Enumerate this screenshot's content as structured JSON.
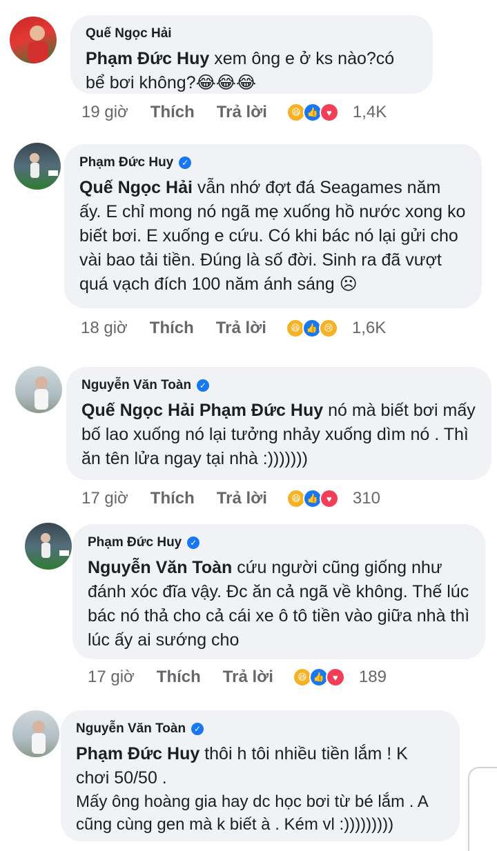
{
  "comments": [
    {
      "author": "Quế Ngọc Hải",
      "verified": false,
      "mention": "Phạm Đức Huy",
      "text": " xem ông e ở ks nào?có bể bơi không?😂😂😂",
      "time": "19 giờ",
      "like_label": "Thích",
      "reply_label": "Trả lời",
      "reactions": [
        "haha",
        "like",
        "love"
      ],
      "reaction_count": "1,4K"
    },
    {
      "author": "Phạm Đức Huy",
      "verified": true,
      "mention": "Quế Ngọc Hải",
      "text": " vẫn nhớ đợt đá Seagames năm ấy. E chỉ mong nó ngã mẹ xuống hồ nước xong ko biết bơi. E xuống e cứu. Có khi bác nó lại gửi cho vài bao tải tiền. Đúng là số đời. Sinh ra đã vượt quá vạch đích 100 năm ánh sáng ☹",
      "time": "18 giờ",
      "like_label": "Thích",
      "reply_label": "Trả lời",
      "reactions": [
        "haha",
        "like",
        "sad"
      ],
      "reaction_count": "1,6K"
    },
    {
      "author": "Nguyễn Văn Toàn",
      "verified": true,
      "mention": "Quế Ngọc Hải  Phạm Đức Huy",
      "text": " nó mà biết bơi mấy bố lao xuống nó lại tưởng nhảy xuống dìm nó . Thì ăn tên lửa ngay tại nhà :)))))))",
      "time": "17 giờ",
      "like_label": "Thích",
      "reply_label": "Trả lời",
      "reactions": [
        "haha",
        "like",
        "love"
      ],
      "reaction_count": "310"
    },
    {
      "author": "Phạm Đức Huy",
      "verified": true,
      "mention": "Nguyễn Văn Toàn",
      "text": " cứu người cũng giống như đánh xóc đĩa vậy. Đc ăn cả ngã về không. Thế lúc bác nó thả cho cả cái xe ô tô tiền vào giữa nhà thì lúc ấy ai sướng cho",
      "time": "17 giờ",
      "like_label": "Thích",
      "reply_label": "Trả lời",
      "reactions": [
        "haha",
        "like",
        "love"
      ],
      "reaction_count": "189"
    },
    {
      "author": "Nguyễn Văn Toàn",
      "verified": true,
      "mention": "Phạm Đức Huy",
      "text": " thôi h tôi nhiều tiền lắm ! K chơi 50/50 .",
      "text2": "Mấy ông hoàng gia hay dc học bơi từ bé lắm . A cũng cùng gen mà k biết à . Kém vl :)))))))))",
      "time": "",
      "like_label": "",
      "reply_label": "",
      "reactions": [],
      "reaction_count": ""
    }
  ],
  "colors": {
    "bubble": "#f0f2f5",
    "secondary_text": "#65676b",
    "verified": "#1877f2"
  }
}
